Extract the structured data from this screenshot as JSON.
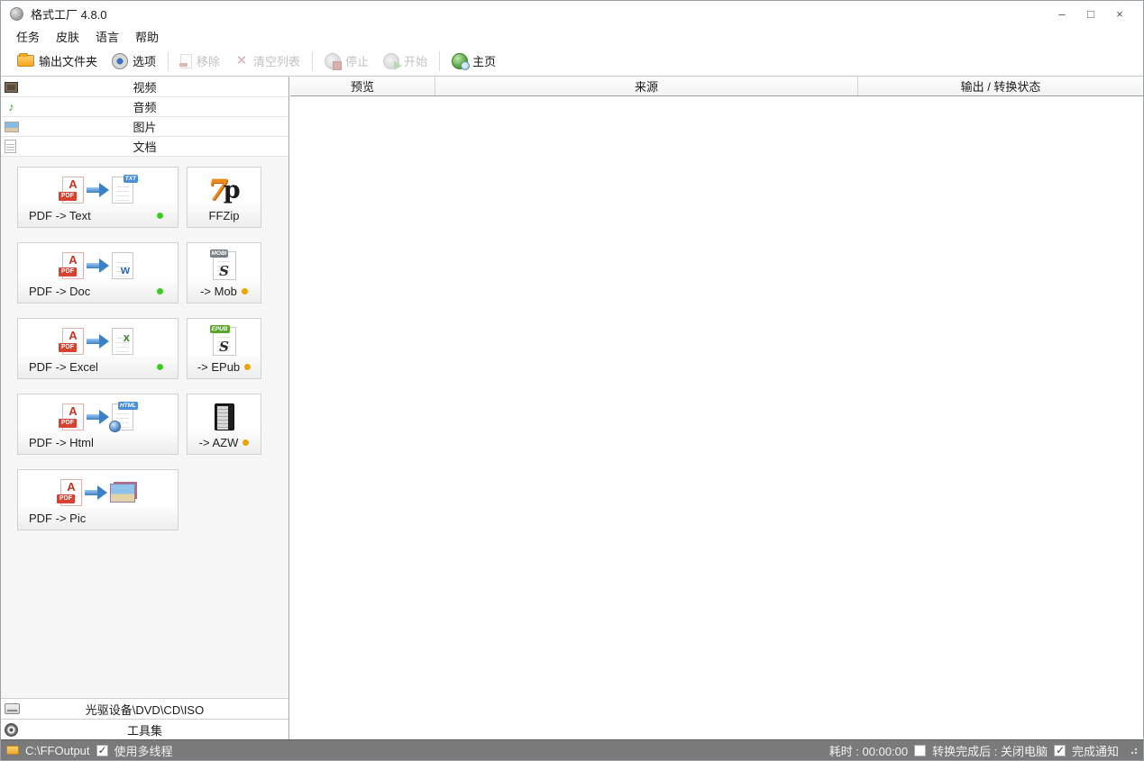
{
  "window": {
    "title": "格式工厂 4.8.0",
    "controls": {
      "minimize": "–",
      "maximize": "□",
      "close": "×"
    }
  },
  "menu": {
    "items": [
      "任务",
      "皮肤",
      "语言",
      "帮助"
    ]
  },
  "toolbar": {
    "buttons": [
      {
        "label": "输出文件夹",
        "icon": "output-folder-icon",
        "enabled": true
      },
      {
        "label": "选项",
        "icon": "options-gear-icon",
        "enabled": true
      },
      {
        "label": "移除",
        "icon": "remove-item-icon",
        "enabled": false
      },
      {
        "label": "清空列表",
        "icon": "clear-list-icon",
        "enabled": false
      },
      {
        "label": "停止",
        "icon": "stop-icon",
        "enabled": false
      },
      {
        "label": "开始",
        "icon": "start-icon",
        "enabled": false
      },
      {
        "label": "主页",
        "icon": "homepage-icon",
        "enabled": true
      }
    ]
  },
  "sidebar": {
    "categories": [
      {
        "label": "视频",
        "icon": "video-category-icon"
      },
      {
        "label": "音频",
        "icon": "audio-category-icon"
      },
      {
        "label": "图片",
        "icon": "picture-category-icon"
      },
      {
        "label": "文档",
        "icon": "document-category-icon"
      }
    ],
    "tiles": [
      {
        "label": "PDF -> Text",
        "dot": "green",
        "icon": "pdf-to-text-icon"
      },
      {
        "label": "FFZip",
        "dot": null,
        "icon": "ffzip-icon"
      },
      {
        "label": "PDF -> Doc",
        "dot": "green",
        "icon": "pdf-to-doc-icon"
      },
      {
        "label": "-> Mob",
        "dot": "orange",
        "icon": "mobi-icon"
      },
      {
        "label": "PDF -> Excel",
        "dot": "green",
        "icon": "pdf-to-excel-icon"
      },
      {
        "label": "-> EPub",
        "dot": "orange",
        "icon": "epub-icon"
      },
      {
        "label": "PDF -> Html",
        "dot": null,
        "icon": "pdf-to-html-icon"
      },
      {
        "label": "-> AZW",
        "dot": "orange",
        "icon": "azw-icon"
      },
      {
        "label": "PDF -> Pic",
        "dot": null,
        "icon": "pdf-to-pic-icon"
      }
    ],
    "bottom_items": [
      {
        "label": "光驱设备\\DVD\\CD\\ISO",
        "icon": "disc-drive-icon"
      },
      {
        "label": "工具集",
        "icon": "toolkit-icon"
      }
    ]
  },
  "main": {
    "columns": [
      "预览",
      "来源",
      "输出 / 转换状态"
    ]
  },
  "statusbar": {
    "output_path": "C:\\FFOutput",
    "multithread_label": "使用多线程",
    "multithread_checked": true,
    "elapsed_label": "耗时 : 00:00:00",
    "shutdown_label": "转换完成后 : 关闭电脑",
    "shutdown_checked": false,
    "notify_label": "完成通知",
    "notify_checked": true
  },
  "icon_labels": {
    "pdf": "PDF",
    "txt": "TXT",
    "html": "HTML",
    "mobi": "MOBI",
    "epub": "EPUB",
    "word_letter": "w",
    "excel_letter": "x",
    "ffzip_7": "7",
    "ffzip_p": "p",
    "snake": "S",
    "pdf_a": "A"
  },
  "colors": {
    "green_dot": "#3ecb20",
    "orange_dot": "#f0a400",
    "pdf_red": "#d8402f",
    "arrow_blue": "#3d7fc4",
    "epub_green": "#5aa52a",
    "statusbar_bg": "#7a7a7a",
    "disabled_text": "#c2c2c2"
  }
}
